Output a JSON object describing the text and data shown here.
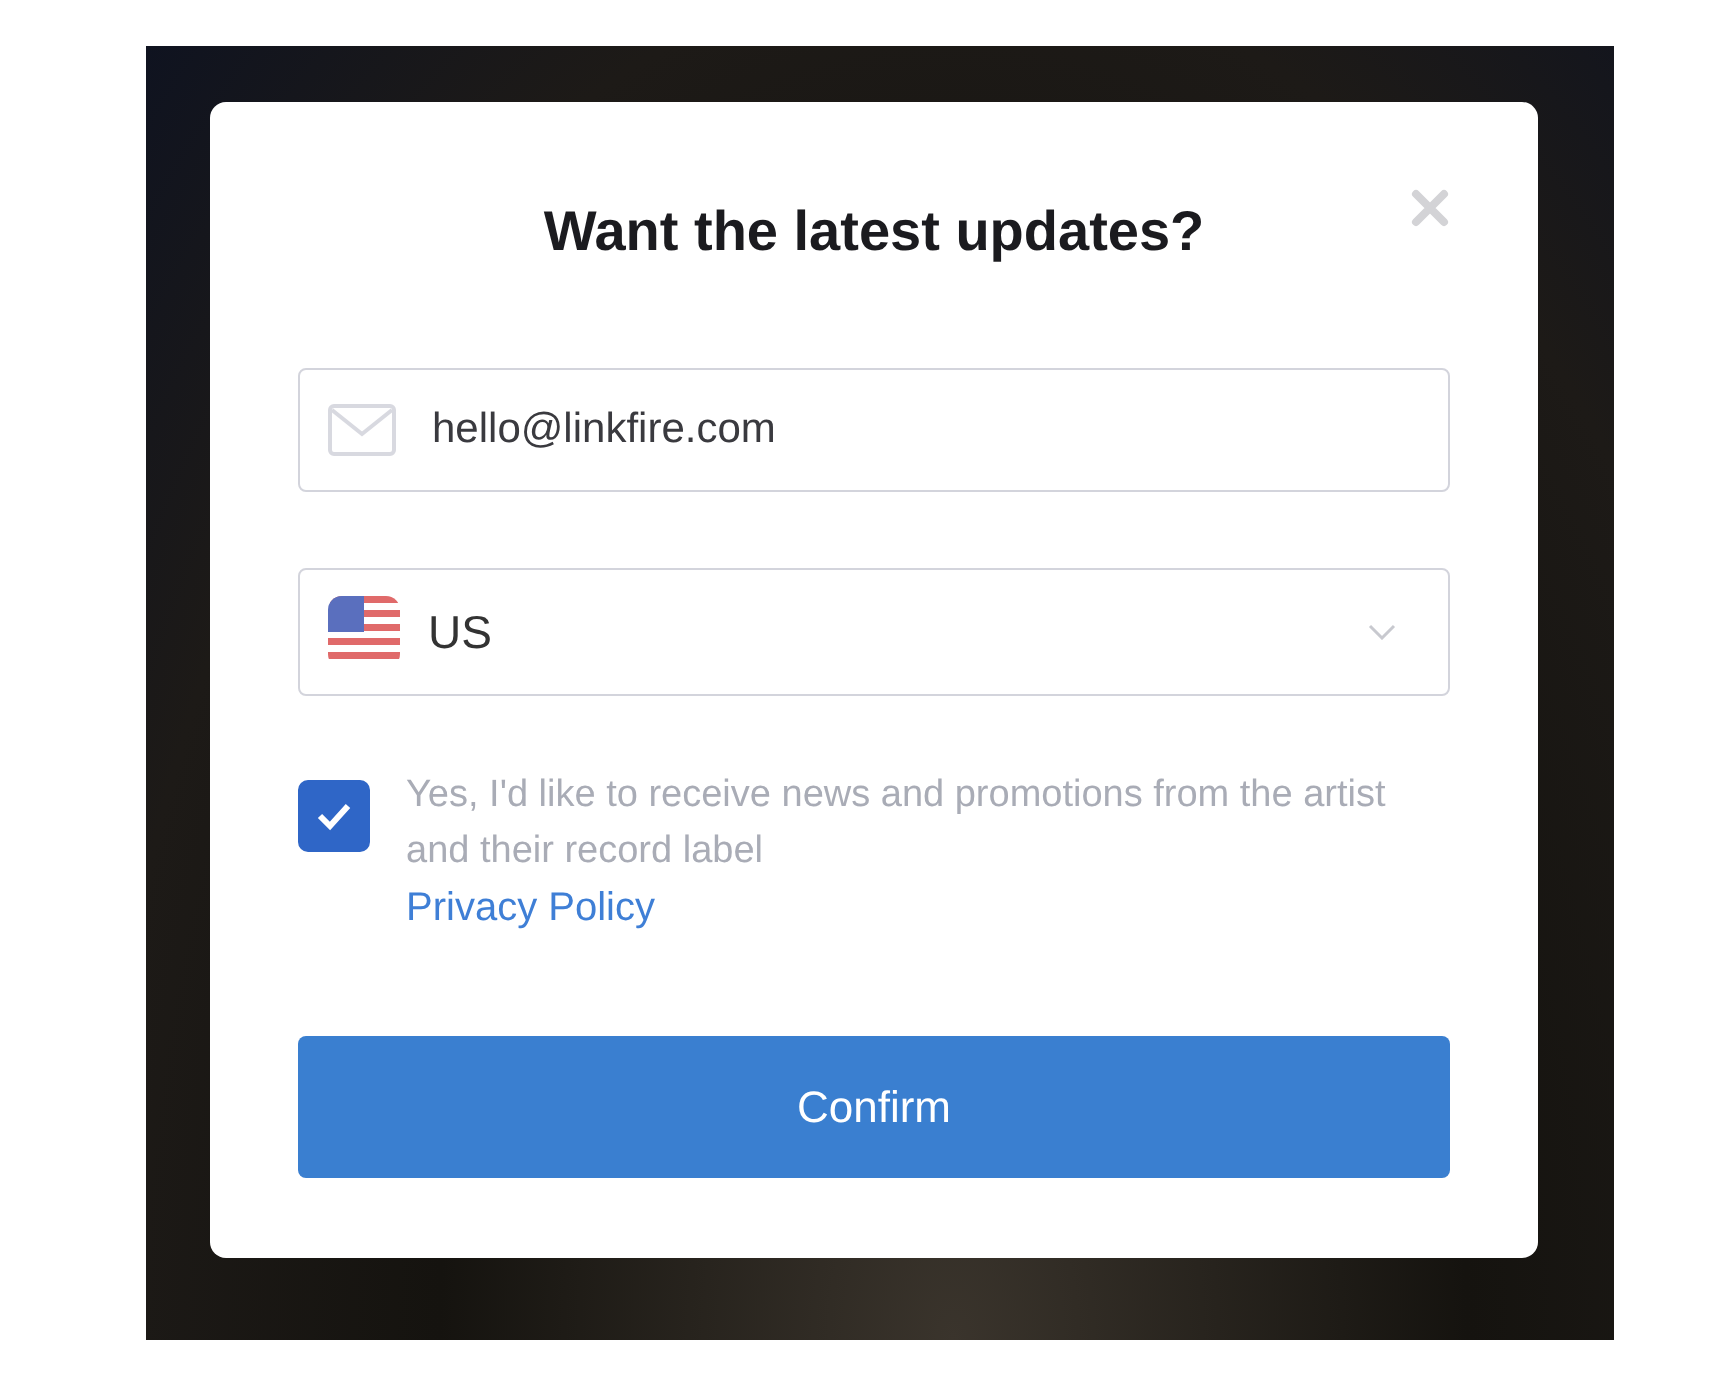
{
  "dialog": {
    "title": "Want the latest updates?",
    "email": {
      "value": "hello@linkfire.com"
    },
    "country": {
      "value": "US"
    },
    "consent": {
      "checked": true,
      "text": "Yes, I'd like to receive news and promotions from the artist and their record label",
      "link": "Privacy Policy"
    },
    "confirm_button": "Confirm"
  }
}
